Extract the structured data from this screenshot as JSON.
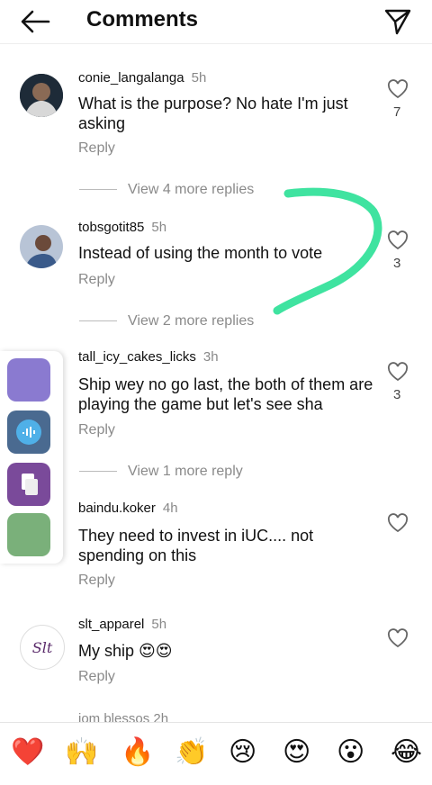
{
  "header": {
    "title": "Comments",
    "back_icon": "back-arrow-icon",
    "send_icon": "send-icon"
  },
  "comments": [
    {
      "username": "conie_langalanga",
      "time": "5h",
      "text": "What is the purpose? No hate I'm just asking",
      "reply": "Reply",
      "likes": "7"
    },
    {
      "username": "tobsgotit85",
      "time": "5h",
      "text": "Instead of using the month to vote",
      "reply": "Reply",
      "likes": "3"
    },
    {
      "username": "tall_icy_cakes_licks",
      "time": "3h",
      "text": "Ship wey no go last, the both of them are playing the game but let's see sha",
      "reply": "Reply",
      "likes": "3"
    },
    {
      "username": "baindu.koker",
      "time": "4h",
      "text": "They need to invest in iUC.... not spending on this",
      "reply": "Reply",
      "likes": ""
    },
    {
      "username": "slt_apparel",
      "time": "5h",
      "text": "My ship 😍😍",
      "reply": "Reply",
      "likes": ""
    }
  ],
  "view_more": [
    "View 4 more replies",
    "View 2 more replies",
    "View 1 more reply"
  ],
  "avatar_text": {
    "slt": "Slt"
  },
  "truncated_next": "iom blessos 2h",
  "emoji_bar": [
    "❤️",
    "🙌",
    "🔥",
    "👏",
    "😢",
    "😍",
    "😮",
    "😂"
  ],
  "colors": {
    "annotation": "#3fe3a0",
    "heart_outline": "#666666"
  }
}
